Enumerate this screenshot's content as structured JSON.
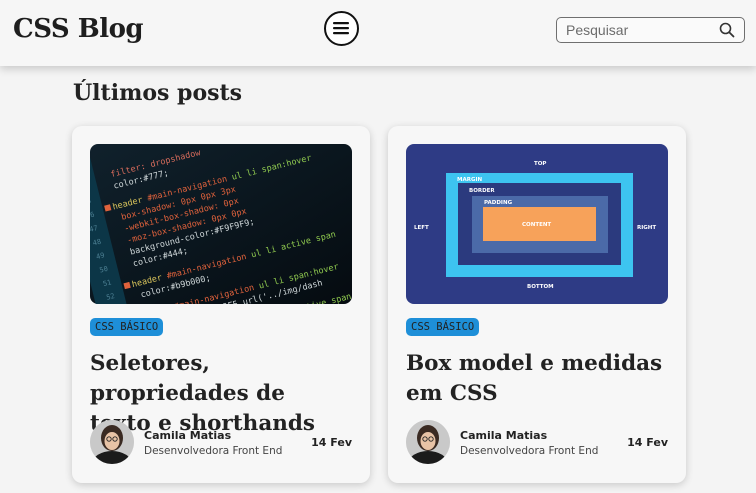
{
  "header": {
    "logo": "CSS Blog",
    "menu_icon": "hamburger-menu-icon",
    "search": {
      "placeholder": "Pesquisar",
      "icon": "search-icon"
    }
  },
  "section": {
    "title": "Últimos posts"
  },
  "posts": [
    {
      "image": "code-editor-screenshot",
      "tag": "CSS BÁSICO",
      "title": "Seletores, propriedades de texto e shorthands",
      "author": {
        "name": "Camila Matias",
        "role": "Desenvolvedora Front End"
      },
      "date": "14 Fev"
    },
    {
      "image": "box-model-diagram",
      "image_labels": {
        "top": "TOP",
        "bottom": "BOTTOM",
        "left": "LEFT",
        "right": "RIGHT",
        "margin": "MARGIN",
        "border": "BORDER",
        "padding": "PADDING",
        "content": "CONTENT"
      },
      "tag": "CSS BÁSICO",
      "title": "Box model e medidas em CSS",
      "author": {
        "name": "Camila Matias",
        "role": "Desenvolvedora Front End"
      },
      "date": "14 Fev"
    }
  ],
  "colors": {
    "background": "#f4f4f4",
    "tag_background": "#1e8fd8",
    "box_model_bg": "#2e3b85",
    "box_model_margin": "#3dc4f0",
    "box_model_border": "#2b3a7e",
    "box_model_padding": "#4b6aa8",
    "box_model_content": "#f7a25a"
  }
}
